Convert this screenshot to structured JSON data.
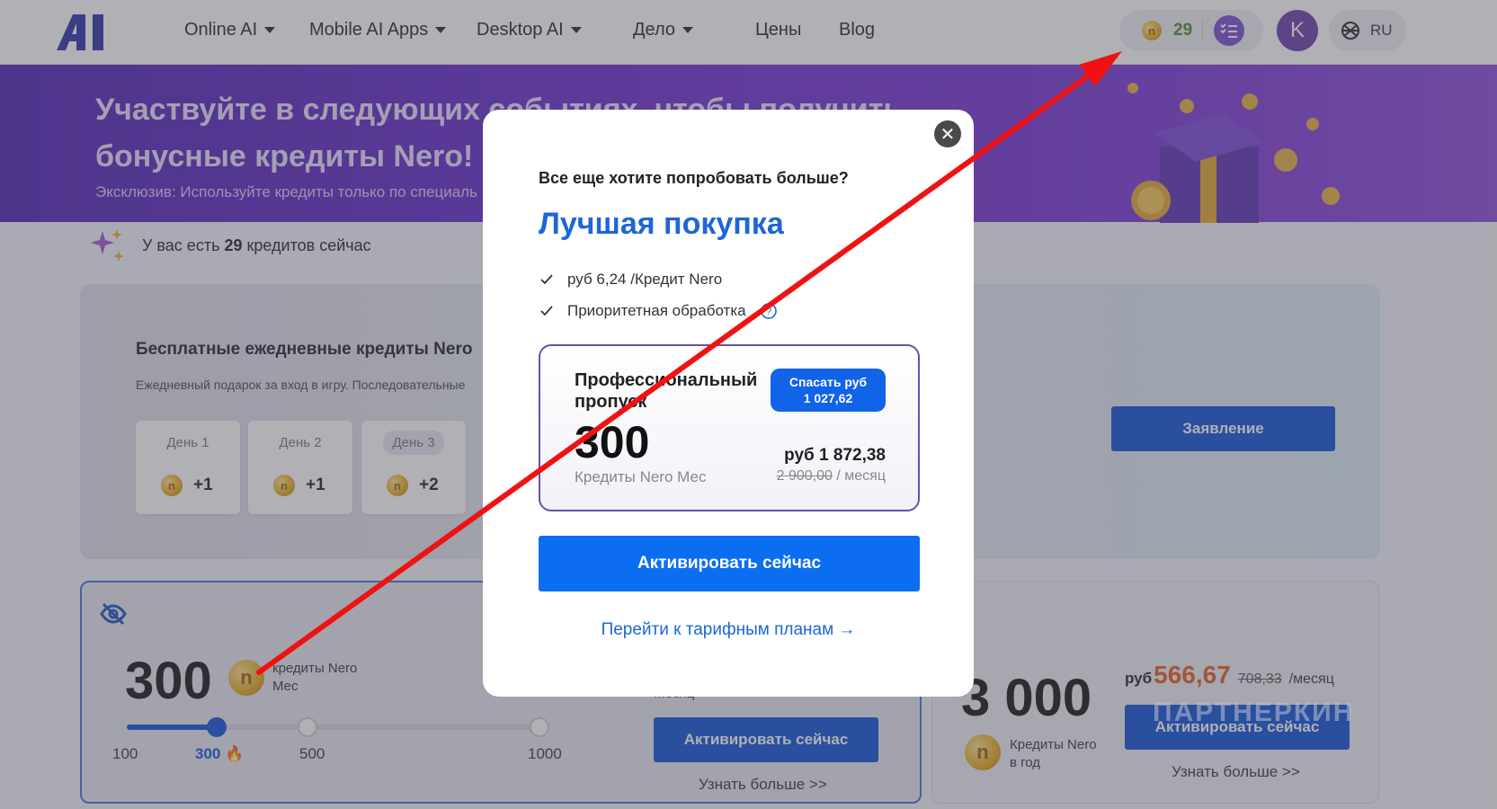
{
  "header": {
    "nav": [
      {
        "label": "Online AI",
        "has_caret": true
      },
      {
        "label": "Mobile AI Apps",
        "has_caret": true
      },
      {
        "label": "Desktop AI",
        "has_caret": true
      },
      {
        "label": "Дело",
        "has_caret": true
      },
      {
        "label": "Цены",
        "has_caret": false
      },
      {
        "label": "Blog",
        "has_caret": false
      }
    ],
    "credits": "29",
    "coin_glyph": "n",
    "avatar_letter": "K",
    "language": "RU"
  },
  "banner": {
    "title_line1": "Участвуйте в следующих событиях, чтобы получить",
    "title_line2": "бонусные кредиты Nero!",
    "subtitle": "Эксклюзив: Используйте кредиты только по специаль"
  },
  "credits_status": {
    "prefix": "У вас есть",
    "count": "29",
    "suffix": "кредитов сейчас"
  },
  "daily": {
    "title": "Бесплатные ежедневные кредиты Nero",
    "subtitle": "Ежедневный подарок за вход в игру. Последовательные",
    "days": [
      {
        "label": "День 1",
        "value": "+1"
      },
      {
        "label": "День 2",
        "value": "+1"
      },
      {
        "label": "День 3",
        "value": "+2"
      }
    ],
    "claim_label": "Заявление"
  },
  "plan_monthly": {
    "amount": "300",
    "unit_line1": "кредиты Nero",
    "unit_line2": "Мес",
    "slider_ticks": [
      "100",
      "300",
      "500",
      "1000"
    ],
    "slider_value": 300,
    "hidden_label": "Месяц",
    "activate_label": "Активировать сейчас",
    "learn_more": "Узнать больше >>"
  },
  "plan_yearly": {
    "currency": "руб",
    "price": "566,67",
    "old_price": "708,33",
    "period": "/месяц",
    "amount": "3 000",
    "unit_line1": "Кредиты Nero",
    "unit_line2": "в год",
    "activate_label": "Активировать сейчас",
    "learn_more": "Узнать больше >>"
  },
  "modal": {
    "question": "Все еще хотите попробовать больше?",
    "headline": "Лучшая покупка",
    "features": [
      "руб 6,24 /Кредит Nero",
      "Приоритетная обработка"
    ],
    "plan_title": "Профессиональный пропуск",
    "save_badge_line1": "Спасать руб",
    "save_badge_line2": "1 027,62",
    "plan_amount": "300",
    "plan_unit": "Кредиты Nero Мес",
    "plan_price": "руб 1 872,38",
    "plan_old_price": "2 900,00",
    "plan_period": " / месяц",
    "activate_label": "Активировать сейчас",
    "plans_link": "Перейти к тарифным планам →",
    "close_glyph": "✕"
  },
  "watermark": "ПАРТНЕРКИН",
  "colors": {
    "brand_blue": "#0e4fd7",
    "modal_cta": "#0b6ef0",
    "headline_blue": "#1d66d8",
    "banner_purple": "#5b22c4",
    "annotation_red": "#f01212",
    "price_orange": "#e85a1a"
  }
}
